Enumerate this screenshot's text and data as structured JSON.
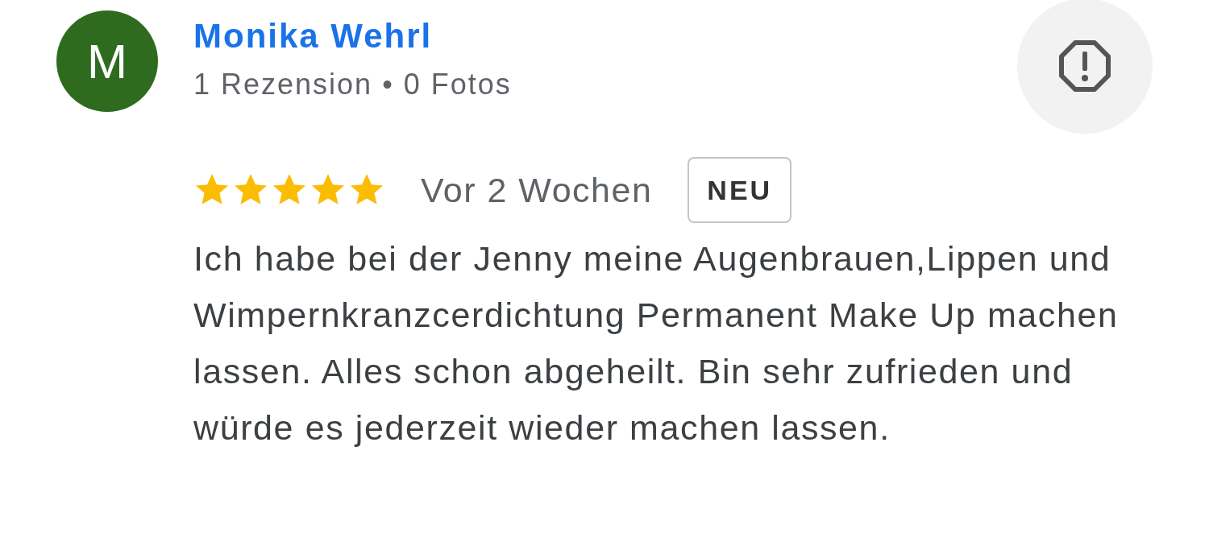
{
  "reviewer": {
    "initial": "M",
    "name": "Monika Wehrl",
    "stats": "1 Rezension • 0 Fotos"
  },
  "review": {
    "stars": 5,
    "time": "Vor 2 Wochen",
    "badge": "NEU",
    "text": "Ich habe bei der Jenny meine Augenbrauen,Lippen und Wimpernkranzcerdichtung Permanent Make Up machen lassen. Alles schon abgeheilt. Bin sehr zufrieden und würde es jederzeit wieder machen lassen."
  }
}
